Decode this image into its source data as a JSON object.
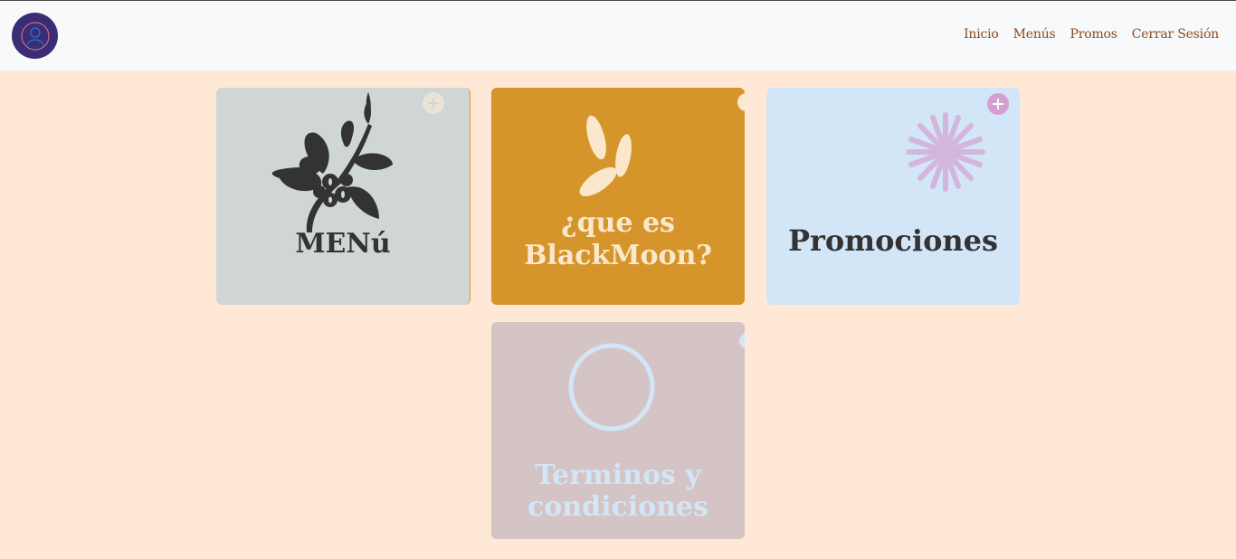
{
  "nav": {
    "links": [
      "Inicio",
      "Menús",
      "Promos",
      "Cerrar Sesión"
    ]
  },
  "cards": [
    {
      "title": "MENú",
      "bg": "#d0d5d6",
      "title_color": "#333333"
    },
    {
      "title_line1": "¿que es",
      "title_line2": "BlackMoon?",
      "bg": "#d6952a",
      "title_color": "#fbe8cc"
    },
    {
      "title": "Promociones",
      "bg": "#d2e6f7",
      "title_color": "#333333"
    },
    {
      "title_line1": "Terminos y",
      "title_line2": "condiciones",
      "bg": "#d4c4c6",
      "title_color": "#d2e6f7"
    }
  ],
  "colors": {
    "page_bg": "#ffe9d6",
    "navbar_bg": "#f8f9fa",
    "link": "#8b4a1e",
    "avatar": "#3a2d73"
  },
  "icons": [
    "user-circle-icon",
    "coffee-branch-icon",
    "leaf-petals-icon",
    "starburst-icon",
    "hand-drawn-circle-icon",
    "plus-circle-icon"
  ]
}
